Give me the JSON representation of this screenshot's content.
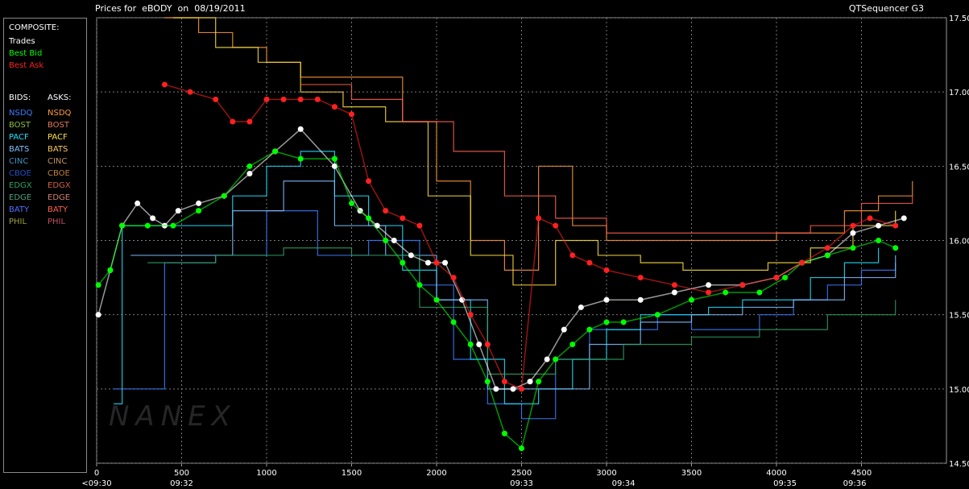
{
  "header": {
    "title": "Prices for  eBODY  on  08/19/2011",
    "app_name": "QTSequencer G3"
  },
  "sidebar": {
    "composite_label": "COMPOSITE:",
    "composite_items": [
      {
        "label": "Trades",
        "color": "#ffffff"
      },
      {
        "label": "Best Bid",
        "color": "#00ff00"
      },
      {
        "label": "Best Ask",
        "color": "#ff2020"
      }
    ],
    "bids_label": "BIDS:",
    "asks_label": "ASKS:",
    "exchanges": [
      {
        "bid": "NSDQ",
        "ask": "NSDQ",
        "bid_color": "#3a7dff",
        "ask_color": "#ff9a3c"
      },
      {
        "bid": "BOST",
        "ask": "BOST",
        "bid_color": "#8fbf3a",
        "ask_color": "#e07a5a"
      },
      {
        "bid": "PACF",
        "ask": "PACF",
        "bid_color": "#20e0ff",
        "ask_color": "#ffe040"
      },
      {
        "bid": "BATS",
        "ask": "BATS",
        "bid_color": "#80c0ff",
        "ask_color": "#ffc860"
      },
      {
        "bid": "CINC",
        "ask": "CINC",
        "bid_color": "#4090c0",
        "ask_color": "#c09060"
      },
      {
        "bid": "CBOE",
        "ask": "CBOE",
        "bid_color": "#2050c0",
        "ask_color": "#c08040"
      },
      {
        "bid": "EDGX",
        "ask": "EDGX",
        "bid_color": "#30a060",
        "ask_color": "#d06040"
      },
      {
        "bid": "EDGE",
        "ask": "EDGE",
        "bid_color": "#50a080",
        "ask_color": "#d08070"
      },
      {
        "bid": "BATY",
        "ask": "BATY",
        "bid_color": "#5070ff",
        "ask_color": "#ff6050"
      },
      {
        "bid": "PHIL",
        "ask": "PHIL",
        "bid_color": "#a0a040",
        "ask_color": "#c05060"
      }
    ]
  },
  "watermark": "NANEX",
  "chart_data": {
    "type": "line",
    "title": "Prices for  eBODY  on  08/19/2011",
    "xlim": [
      0,
      5000
    ],
    "ylim": [
      14.5,
      17.5
    ],
    "x_ticks": [
      0,
      500,
      1000,
      1500,
      2000,
      2500,
      3000,
      3500,
      4000,
      4500
    ],
    "y_ticks": [
      14.5,
      15.0,
      15.5,
      16.0,
      16.5,
      17.0,
      17.5
    ],
    "y_tick_labels": [
      "14.50",
      "15.00",
      "15.50",
      "16.00",
      "16.50",
      "17.00",
      "17.50"
    ],
    "time_labels": [
      {
        "x": 0,
        "label": "<09:30"
      },
      {
        "x": 500,
        "label": "09:32"
      },
      {
        "x": 2500,
        "label": "09:33"
      },
      {
        "x": 3100,
        "label": "09:34"
      },
      {
        "x": 4050,
        "label": "09:35"
      },
      {
        "x": 4460,
        "label": "09:36"
      }
    ],
    "grid": true,
    "series": [
      {
        "name": "Trades",
        "color": "#ffffff",
        "x": [
          10,
          80,
          150,
          240,
          330,
          400,
          480,
          600,
          750,
          900,
          1050,
          1200,
          1400,
          1550,
          1650,
          1750,
          1850,
          1950,
          2050,
          2150,
          2250,
          2350,
          2450,
          2550,
          2650,
          2750,
          2850,
          3000,
          3200,
          3400,
          3600,
          3800,
          4000,
          4150,
          4300,
          4450,
          4600,
          4750
        ],
        "values": [
          15.5,
          15.8,
          16.1,
          16.25,
          16.15,
          16.1,
          16.2,
          16.25,
          16.3,
          16.45,
          16.6,
          16.75,
          16.5,
          16.2,
          16.1,
          16.0,
          15.9,
          15.85,
          15.85,
          15.6,
          15.3,
          15.0,
          15.0,
          15.05,
          15.2,
          15.4,
          15.55,
          15.6,
          15.6,
          15.65,
          15.7,
          15.7,
          15.75,
          15.85,
          15.9,
          16.05,
          16.1,
          16.15
        ]
      },
      {
        "name": "Best Bid",
        "color": "#00ff00",
        "x": [
          10,
          80,
          150,
          300,
          450,
          600,
          750,
          900,
          1050,
          1200,
          1400,
          1500,
          1600,
          1700,
          1800,
          1900,
          2000,
          2100,
          2200,
          2300,
          2400,
          2500,
          2600,
          2700,
          2800,
          2900,
          3000,
          3100,
          3300,
          3500,
          3700,
          3900,
          4050,
          4150,
          4300,
          4450,
          4600,
          4700
        ],
        "values": [
          15.7,
          15.8,
          16.1,
          16.1,
          16.1,
          16.2,
          16.3,
          16.5,
          16.6,
          16.55,
          16.55,
          16.25,
          16.15,
          16.0,
          15.85,
          15.7,
          15.6,
          15.45,
          15.3,
          15.05,
          14.7,
          14.6,
          15.05,
          15.2,
          15.3,
          15.4,
          15.45,
          15.45,
          15.5,
          15.6,
          15.65,
          15.65,
          15.75,
          15.85,
          15.9,
          15.95,
          16.0,
          15.95
        ]
      },
      {
        "name": "Best Ask",
        "color": "#ff2020",
        "x": [
          400,
          550,
          700,
          800,
          900,
          1000,
          1100,
          1200,
          1300,
          1400,
          1500,
          1600,
          1700,
          1800,
          1900,
          2000,
          2100,
          2200,
          2300,
          2400,
          2500,
          2600,
          2700,
          2800,
          2900,
          3000,
          3200,
          3400,
          3600,
          3800,
          4000,
          4150,
          4300,
          4450,
          4550,
          4700
        ],
        "values": [
          17.05,
          17.0,
          16.95,
          16.8,
          16.8,
          16.95,
          16.95,
          16.95,
          16.95,
          16.9,
          16.85,
          16.4,
          16.2,
          16.15,
          16.1,
          15.85,
          15.75,
          15.5,
          15.3,
          15.05,
          15.0,
          16.15,
          16.1,
          15.9,
          15.85,
          15.8,
          15.75,
          15.7,
          15.65,
          15.7,
          15.75,
          15.85,
          15.95,
          16.1,
          16.15,
          16.1
        ]
      },
      {
        "name": "NSDQ",
        "color": "#3a7dff",
        "x": [
          100,
          400,
          700,
          1000,
          1300,
          1600,
          1900,
          2100,
          2300,
          2500,
          2700,
          2900,
          3100,
          3300,
          3500,
          3700,
          3900,
          4100,
          4300,
          4500,
          4700
        ],
        "values": [
          15.0,
          15.85,
          15.9,
          16.2,
          15.9,
          16.0,
          15.7,
          15.2,
          14.9,
          14.8,
          15.2,
          15.4,
          15.4,
          15.5,
          15.4,
          15.4,
          15.5,
          15.6,
          15.7,
          15.8,
          15.85
        ]
      },
      {
        "name": "PACF",
        "color": "#20e0ff",
        "x": [
          100,
          150,
          300,
          600,
          800,
          1000,
          1200,
          1400,
          1600,
          1800,
          2000,
          2200,
          2400,
          2600,
          2800,
          3000,
          3200,
          3400,
          3600,
          3800,
          4000,
          4200,
          4400,
          4600
        ],
        "values": [
          14.9,
          16.1,
          16.1,
          16.1,
          16.3,
          16.5,
          16.6,
          16.3,
          16.1,
          15.8,
          15.6,
          15.2,
          14.9,
          15.0,
          15.2,
          15.4,
          15.5,
          15.5,
          15.55,
          15.6,
          15.6,
          15.75,
          15.85,
          15.95
        ]
      },
      {
        "name": "BATS",
        "color": "#80c0ff",
        "x": [
          200,
          500,
          800,
          1100,
          1400,
          1700,
          2000,
          2300,
          2600,
          2900,
          3200,
          3500,
          3800,
          4100,
          4400,
          4700
        ],
        "values": [
          15.9,
          15.9,
          16.2,
          16.4,
          16.1,
          15.9,
          15.6,
          15.0,
          15.0,
          15.3,
          15.45,
          15.5,
          15.55,
          15.6,
          15.75,
          15.9
        ]
      },
      {
        "name": "EDGX",
        "color": "#30a060",
        "x": [
          300,
          700,
          1100,
          1500,
          1900,
          2300,
          2700,
          3100,
          3500,
          3900,
          4300,
          4700
        ],
        "values": [
          15.85,
          15.9,
          15.95,
          15.9,
          15.55,
          15.1,
          15.2,
          15.3,
          15.35,
          15.4,
          15.5,
          15.6
        ]
      },
      {
        "name": "NSDQ ask",
        "color": "#ff9a3c",
        "x": [
          400,
          600,
          800,
          1000,
          1200,
          1400,
          1600,
          1800,
          2000,
          2200,
          2400,
          2600,
          2800,
          3000,
          3200,
          3400,
          3600,
          3800,
          4000,
          4200,
          4400,
          4600,
          4800
        ],
        "values": [
          17.5,
          17.4,
          17.3,
          17.2,
          17.1,
          17.1,
          17.1,
          16.8,
          16.4,
          16.0,
          15.8,
          16.5,
          16.1,
          16.0,
          16.0,
          16.0,
          16.0,
          16.0,
          16.05,
          16.05,
          16.2,
          16.3,
          16.4
        ]
      },
      {
        "name": "PACF ask",
        "color": "#ffe040",
        "x": [
          450,
          700,
          950,
          1200,
          1450,
          1700,
          1950,
          2200,
          2450,
          2700,
          2950,
          3200,
          3450,
          3700,
          3950,
          4200,
          4450,
          4700
        ],
        "values": [
          17.5,
          17.3,
          17.2,
          17.0,
          16.9,
          16.8,
          16.3,
          15.9,
          15.7,
          16.0,
          15.9,
          15.85,
          15.8,
          15.8,
          15.85,
          15.95,
          16.1,
          16.2
        ]
      },
      {
        "name": "BATY ask",
        "color": "#ff6050",
        "x": [
          1200,
          1500,
          1800,
          2100,
          2400,
          2700,
          3000,
          3300,
          3600,
          3900,
          4200,
          4500,
          4800
        ],
        "values": [
          17.05,
          16.95,
          16.8,
          16.6,
          16.3,
          16.15,
          16.05,
          16.05,
          16.05,
          16.05,
          16.1,
          16.25,
          16.3
        ]
      }
    ]
  }
}
